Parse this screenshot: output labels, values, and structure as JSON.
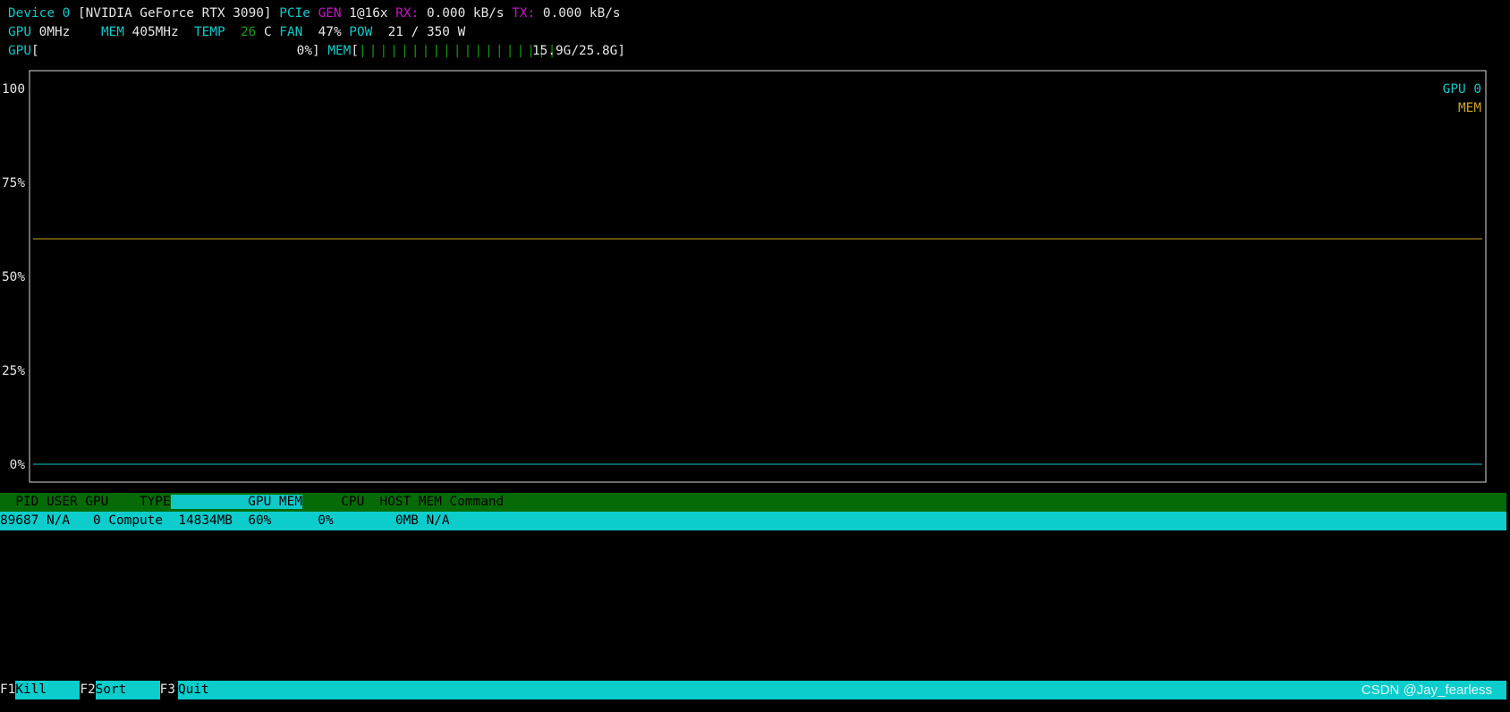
{
  "header": {
    "device_label": "Device 0",
    "device_name": "[NVIDIA GeForce RTX 3090]",
    "pcie_label": "PCIe",
    "gen_label": "GEN",
    "gen_value": "1@16x",
    "rx_label": "RX:",
    "rx_value": "0.000 kB/s",
    "tx_label": "TX:",
    "tx_value": "0.000 kB/s",
    "gpu_clock_label": "GPU",
    "gpu_clock_value": "0MHz",
    "mem_clock_label": "MEM",
    "mem_clock_value": "405MHz",
    "temp_label": "TEMP",
    "temp_value": "26",
    "temp_unit": "C",
    "fan_label": "FAN",
    "fan_value": "47%",
    "pow_label": "POW",
    "pow_value": "21 / 350 W",
    "gpu_gauge_label": "GPU",
    "gpu_gauge_open": "[",
    "gpu_gauge_value": "0%]",
    "mem_gauge_label": "MEM",
    "mem_gauge_open": "[",
    "mem_gauge_bars": "|||||||||||||||||||",
    "mem_gauge_value": "15.9G/25.8G]",
    "mem_gauge_fraction": 0.616
  },
  "chart_data": {
    "type": "line",
    "ylim": [
      0,
      100
    ],
    "y_ticks": [
      "100",
      "75%",
      "50%",
      "25%",
      "0%"
    ],
    "y_tick_values": [
      100,
      75,
      50,
      25,
      0
    ],
    "legend": [
      "GPU 0",
      "MEM"
    ],
    "legend_placement": "top-right",
    "series": [
      {
        "name": "GPU 0",
        "color": "#12c7c7",
        "values": [
          0,
          0
        ]
      },
      {
        "name": "MEM",
        "color": "#c9a51c",
        "values": [
          60,
          60
        ]
      }
    ]
  },
  "process_table": {
    "columns": [
      {
        "key": "pid",
        "label": "  PID"
      },
      {
        "key": "user",
        "label": " USER"
      },
      {
        "key": "gpu",
        "label": " GPU"
      },
      {
        "key": "type",
        "label": "    TYPE"
      },
      {
        "key": "pad",
        "label": "    "
      },
      {
        "key": "gpu_mem",
        "label": "      GPU MEM"
      },
      {
        "key": "cpu",
        "label": "     CPU"
      },
      {
        "key": "host_mem",
        "label": "  HOST MEM"
      },
      {
        "key": "command",
        "label": " Command"
      }
    ],
    "rows": [
      {
        "pid": "89687",
        "user": "N/A",
        "gpu": "0",
        "type": "Compute",
        "gpu_mem": "14834MB",
        "gpu_mem_pct": "60%",
        "cpu": "0%",
        "host_mem": "0MB",
        "command": "N/A"
      }
    ]
  },
  "footer": {
    "keys": [
      {
        "key": "F1",
        "label": "Kill"
      },
      {
        "key": "F2",
        "label": "Sort"
      },
      {
        "key": "F3",
        "label": "Quit"
      }
    ],
    "watermark": "CSDN @Jay_fearless"
  }
}
